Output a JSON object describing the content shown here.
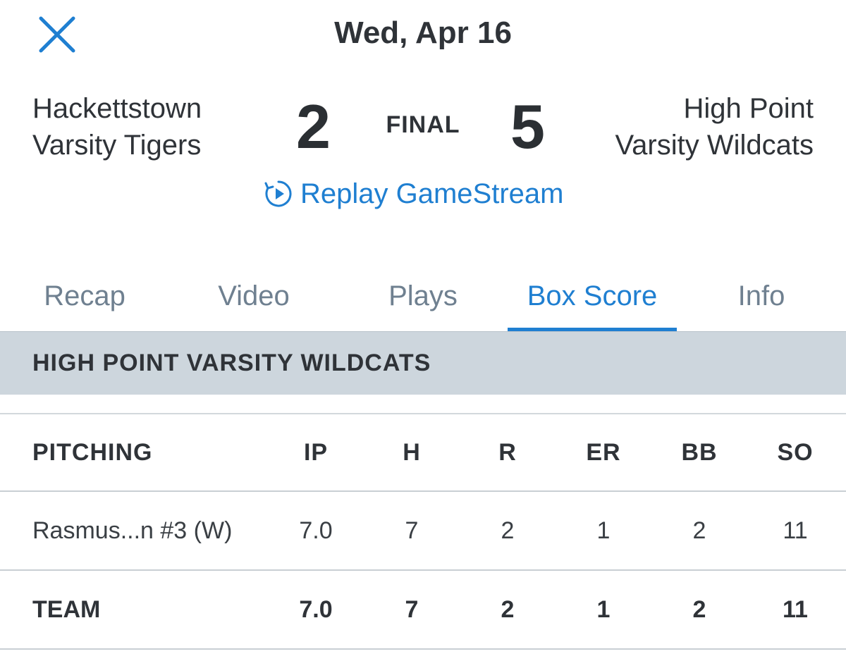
{
  "header": {
    "date": "Wed, Apr 16",
    "close_icon": "close-icon"
  },
  "game": {
    "home_team_line1": "Hackettstown",
    "home_team_line2": "Varsity Tigers",
    "home_score": "2",
    "status": "FINAL",
    "away_score": "5",
    "away_team_line1": "High Point",
    "away_team_line2": "Varsity Wildcats",
    "replay_label": "Replay GameStream",
    "replay_icon": "replay-play-icon"
  },
  "tabs": [
    {
      "label": "Recap",
      "active": false
    },
    {
      "label": "Video",
      "active": false
    },
    {
      "label": "Plays",
      "active": false
    },
    {
      "label": "Box Score",
      "active": true
    },
    {
      "label": "Info",
      "active": false
    }
  ],
  "section": {
    "title": "HIGH POINT VARSITY WILDCATS"
  },
  "pitching_table": {
    "columns": [
      "PITCHING",
      "IP",
      "H",
      "R",
      "ER",
      "BB",
      "SO"
    ],
    "rows": [
      [
        "Rasmus...n #3 (W)",
        "7.0",
        "7",
        "2",
        "1",
        "2",
        "11"
      ]
    ],
    "total": [
      "TEAM",
      "7.0",
      "7",
      "2",
      "1",
      "2",
      "11"
    ]
  },
  "colors": {
    "accent": "#1f7fd1",
    "text": "#2f3338",
    "tab_inactive": "#6f8090",
    "section_bg": "#cdd6dd"
  }
}
